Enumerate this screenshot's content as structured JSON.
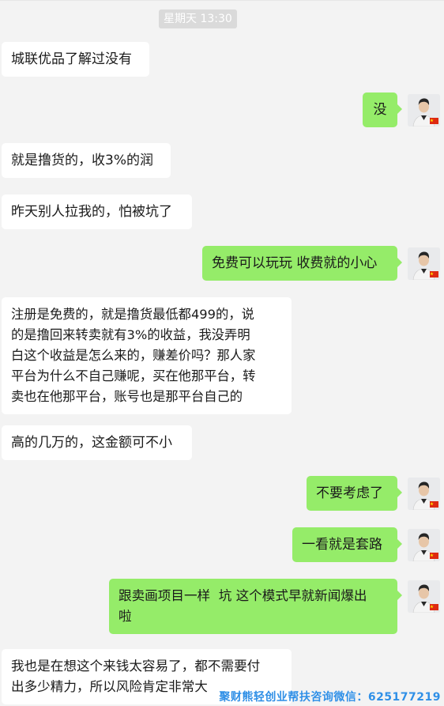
{
  "chat": {
    "timestamp": "星期天 13:30",
    "messages": [
      {
        "id": "m1",
        "side": "in",
        "text": "城联优品了解过没有"
      },
      {
        "id": "m2",
        "side": "out",
        "text": "没"
      },
      {
        "id": "m3",
        "side": "in",
        "text": "就是撸货的，收3%的润"
      },
      {
        "id": "m4",
        "side": "in",
        "text": "昨天别人拉我的，怕被坑了"
      },
      {
        "id": "m5",
        "side": "out",
        "text": "免费可以玩玩 收费就的小心"
      },
      {
        "id": "m6",
        "side": "in",
        "text": "注册是免费的，就是撸货最低都499的，说\n的是撸回来转卖就有3%的收益，我没弄明\n白这个收益是怎么来的，赚差价吗？那人家\n平台为什么不自己赚呢，买在他那平台，转\n卖也在他那平台，账号也是那平台自己的"
      },
      {
        "id": "m7",
        "side": "in",
        "text": "高的几万的，这金额可不小"
      },
      {
        "id": "m8",
        "side": "out",
        "text": "不要考虑了"
      },
      {
        "id": "m9",
        "side": "out",
        "text": "一看就是套路"
      },
      {
        "id": "m10",
        "side": "out",
        "text": "跟卖画项目一样  坑 这个模式早就新闻爆出\n啦"
      },
      {
        "id": "m11",
        "side": "in",
        "text": "我也是在想这个来钱太容易了，都不需要付\n出多少精力，所以风险肯定非常大"
      }
    ]
  },
  "watermark": "聚财熊轻创业帮扶咨询微信：625177219",
  "colors": {
    "background": "#f3f3f3",
    "incoming_bubble": "#ffffff",
    "outgoing_bubble": "#95ec69",
    "watermark": "#2f8fe6"
  },
  "icons": {
    "avatar": "user-avatar-icon",
    "flag": "china-flag-icon"
  }
}
